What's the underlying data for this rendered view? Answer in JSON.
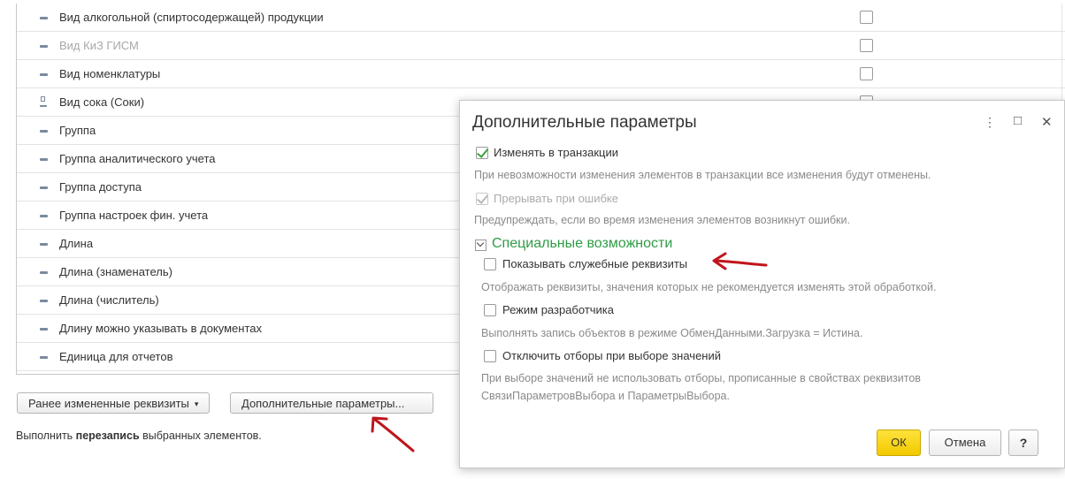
{
  "table": {
    "rows": [
      {
        "label": "Вид алкогольной (спиртосодержащей) продукции",
        "dim": false,
        "icon": "dash-icon"
      },
      {
        "label": "Вид КиЗ ГИСМ",
        "dim": true,
        "icon": "dash-icon"
      },
      {
        "label": "Вид номенклатуры",
        "dim": false,
        "icon": "dash-icon"
      },
      {
        "label": "Вид сока (Соки)",
        "dim": false,
        "icon": "tree-icon"
      },
      {
        "label": "Группа",
        "dim": false,
        "icon": "dash-icon"
      },
      {
        "label": "Группа аналитического учета",
        "dim": false,
        "icon": "dash-icon"
      },
      {
        "label": "Группа доступа",
        "dim": false,
        "icon": "dash-icon"
      },
      {
        "label": "Группа настроек фин. учета",
        "dim": false,
        "icon": "dash-icon"
      },
      {
        "label": "Длина",
        "dim": false,
        "icon": "dash-icon"
      },
      {
        "label": "Длина (знаменатель)",
        "dim": false,
        "icon": "dash-icon"
      },
      {
        "label": "Длина (числитель)",
        "dim": false,
        "icon": "dash-icon"
      },
      {
        "label": "Длину можно указывать в документах",
        "dim": false,
        "icon": "dash-icon"
      },
      {
        "label": "Единица для отчетов",
        "dim": false,
        "icon": "dash-icon"
      }
    ]
  },
  "footer": {
    "prev_changed_label": "Ранее измененные реквизиты",
    "extra_params_label": "Дополнительные параметры...",
    "hint_prefix": "Выполнить ",
    "hint_bold": "перезапись",
    "hint_suffix": " выбранных элементов."
  },
  "dialog": {
    "title": "Дополнительные параметры",
    "change_in_transaction": {
      "label": "Изменять в транзакции",
      "checked": true
    },
    "change_in_transaction_hint": "При невозможности изменения элементов в транзакции все изменения будут отменены.",
    "abort_on_error": {
      "label": "Прерывать при ошибке",
      "checked": true,
      "disabled": true
    },
    "abort_on_error_hint": "Предупреждать, если во время изменения элементов возникнут ошибки.",
    "special_section": "Специальные возможности",
    "show_service": {
      "label": "Показывать служебные реквизиты",
      "checked": false
    },
    "show_service_hint": "Отображать реквизиты, значения которых не рекомендуется изменять этой обработкой.",
    "dev_mode": {
      "label": "Режим разработчика",
      "checked": false
    },
    "dev_mode_hint": "Выполнять запись объектов в режиме ОбменДанными.Загрузка = Истина.",
    "disable_filters": {
      "label": "Отключить отборы при выборе значений",
      "checked": false
    },
    "disable_filters_hint_1": "При выборе значений не использовать отборы, прописанные в свойствах реквизитов",
    "disable_filters_hint_2": "СвязиПараметровВыбора и ПараметрыВыбора.",
    "ok_label": "ОК",
    "cancel_label": "Отмена",
    "help_label": "?",
    "menu_glyph": "⋮",
    "maximize_glyph": "□",
    "close_glyph": "✕"
  },
  "colors": {
    "accent_green": "#2e9c45",
    "ok_yellow": "#f2c900",
    "annotation_red": "#c0151c"
  }
}
